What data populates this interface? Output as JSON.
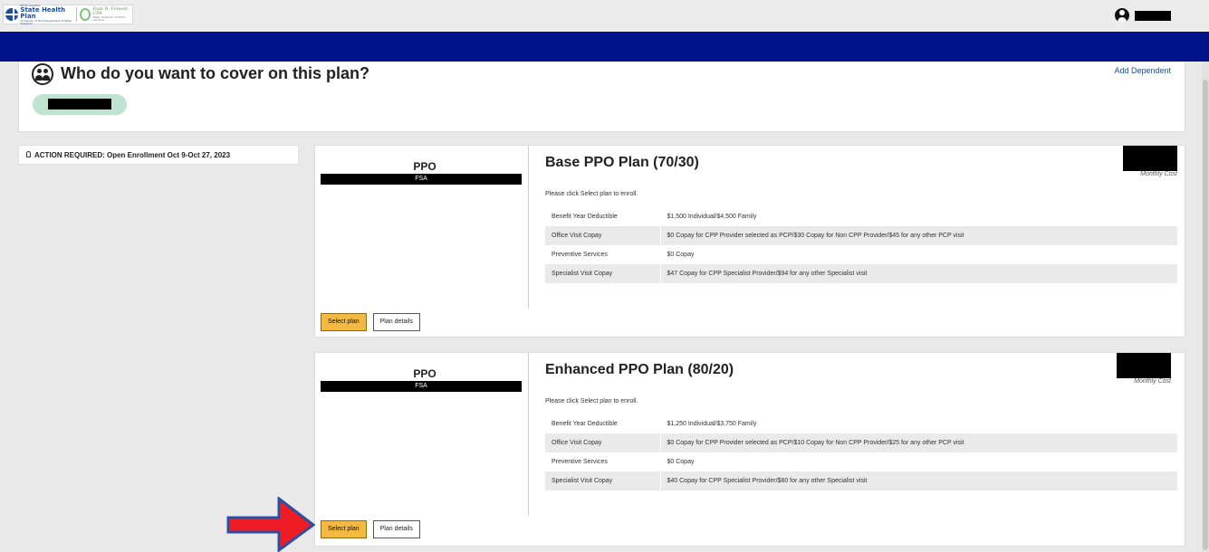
{
  "header": {
    "logo": {
      "org_small": "North Carolina",
      "org_name": "State Health Plan",
      "org_tagline": "A Division of the Department of State Treasurer",
      "treasurer_script": "Dale R. Folwell, CPA",
      "treasurer_sub": "State Treasurer of North Carolina"
    },
    "user_icon": "user-icon"
  },
  "cover": {
    "title": "Who do you want to cover on this plan?",
    "add_dependent": "Add Dependent",
    "icon": "people-icon"
  },
  "notice": {
    "text": "ACTION REQUIRED: Open Enrollment Oct 9-Oct 27, 2023",
    "icon": "lightbulb-icon"
  },
  "plans": [
    {
      "type": "PPO",
      "account": "FSA",
      "name": "Base PPO Plan (70/30)",
      "cost_label": "Monthly Cost",
      "instruction": "Please click Select plan to enroll.",
      "benefits": [
        {
          "label": "Benefit Year Deductible",
          "value": "$1,500 Individual/$4,500 Family"
        },
        {
          "label": "Office Visit Copay",
          "value": "$0 Copay for CPP Provider selected as PCP/$30 Copay for Non CPP Provider/$45 for any other PCP visit"
        },
        {
          "label": "Preventive Services",
          "value": "$0 Copay"
        },
        {
          "label": "Specialist Visit Copay",
          "value": "$47 Copay for CPP Specialist Provider/$94 for any other Specialist visit"
        }
      ],
      "select_label": "Select plan",
      "details_label": "Plan details"
    },
    {
      "type": "PPO",
      "account": "FSA",
      "name": "Enhanced PPO Plan (80/20)",
      "cost_label": "Monthly Cost",
      "instruction": "Please click Select plan to enroll.",
      "benefits": [
        {
          "label": "Benefit Year Deductible",
          "value": "$1,250 Individual/$3,750 Family"
        },
        {
          "label": "Office Visit Copay",
          "value": "$0 Copay for CPP Provider selected as PCP/$10 Copay for Non CPP Provider/$25 for any other PCP visit"
        },
        {
          "label": "Preventive Services",
          "value": "$0 Copay"
        },
        {
          "label": "Specialist Visit Copay",
          "value": "$40 Copay for CPP Specialist Provider/$80 for any other Specialist visit"
        }
      ],
      "select_label": "Select plan",
      "details_label": "Plan details"
    }
  ],
  "annotation": {
    "arrow_color": "#ee1c24",
    "arrow_outline": "#2f4fa2"
  },
  "colors": {
    "navbar": "#00138a",
    "select_button": "#f3b940",
    "member_pill": "#bfe3d1"
  }
}
